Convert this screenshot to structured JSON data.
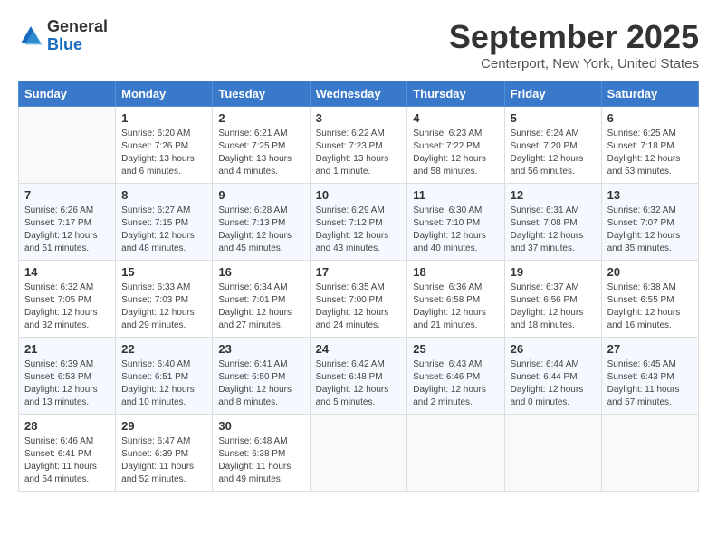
{
  "header": {
    "logo_general": "General",
    "logo_blue": "Blue",
    "month_year": "September 2025",
    "location": "Centerport, New York, United States"
  },
  "days_of_week": [
    "Sunday",
    "Monday",
    "Tuesday",
    "Wednesday",
    "Thursday",
    "Friday",
    "Saturday"
  ],
  "weeks": [
    [
      {
        "day": "",
        "info": ""
      },
      {
        "day": "1",
        "info": "Sunrise: 6:20 AM\nSunset: 7:26 PM\nDaylight: 13 hours\nand 6 minutes."
      },
      {
        "day": "2",
        "info": "Sunrise: 6:21 AM\nSunset: 7:25 PM\nDaylight: 13 hours\nand 4 minutes."
      },
      {
        "day": "3",
        "info": "Sunrise: 6:22 AM\nSunset: 7:23 PM\nDaylight: 13 hours\nand 1 minute."
      },
      {
        "day": "4",
        "info": "Sunrise: 6:23 AM\nSunset: 7:22 PM\nDaylight: 12 hours\nand 58 minutes."
      },
      {
        "day": "5",
        "info": "Sunrise: 6:24 AM\nSunset: 7:20 PM\nDaylight: 12 hours\nand 56 minutes."
      },
      {
        "day": "6",
        "info": "Sunrise: 6:25 AM\nSunset: 7:18 PM\nDaylight: 12 hours\nand 53 minutes."
      }
    ],
    [
      {
        "day": "7",
        "info": "Sunrise: 6:26 AM\nSunset: 7:17 PM\nDaylight: 12 hours\nand 51 minutes."
      },
      {
        "day": "8",
        "info": "Sunrise: 6:27 AM\nSunset: 7:15 PM\nDaylight: 12 hours\nand 48 minutes."
      },
      {
        "day": "9",
        "info": "Sunrise: 6:28 AM\nSunset: 7:13 PM\nDaylight: 12 hours\nand 45 minutes."
      },
      {
        "day": "10",
        "info": "Sunrise: 6:29 AM\nSunset: 7:12 PM\nDaylight: 12 hours\nand 43 minutes."
      },
      {
        "day": "11",
        "info": "Sunrise: 6:30 AM\nSunset: 7:10 PM\nDaylight: 12 hours\nand 40 minutes."
      },
      {
        "day": "12",
        "info": "Sunrise: 6:31 AM\nSunset: 7:08 PM\nDaylight: 12 hours\nand 37 minutes."
      },
      {
        "day": "13",
        "info": "Sunrise: 6:32 AM\nSunset: 7:07 PM\nDaylight: 12 hours\nand 35 minutes."
      }
    ],
    [
      {
        "day": "14",
        "info": "Sunrise: 6:32 AM\nSunset: 7:05 PM\nDaylight: 12 hours\nand 32 minutes."
      },
      {
        "day": "15",
        "info": "Sunrise: 6:33 AM\nSunset: 7:03 PM\nDaylight: 12 hours\nand 29 minutes."
      },
      {
        "day": "16",
        "info": "Sunrise: 6:34 AM\nSunset: 7:01 PM\nDaylight: 12 hours\nand 27 minutes."
      },
      {
        "day": "17",
        "info": "Sunrise: 6:35 AM\nSunset: 7:00 PM\nDaylight: 12 hours\nand 24 minutes."
      },
      {
        "day": "18",
        "info": "Sunrise: 6:36 AM\nSunset: 6:58 PM\nDaylight: 12 hours\nand 21 minutes."
      },
      {
        "day": "19",
        "info": "Sunrise: 6:37 AM\nSunset: 6:56 PM\nDaylight: 12 hours\nand 18 minutes."
      },
      {
        "day": "20",
        "info": "Sunrise: 6:38 AM\nSunset: 6:55 PM\nDaylight: 12 hours\nand 16 minutes."
      }
    ],
    [
      {
        "day": "21",
        "info": "Sunrise: 6:39 AM\nSunset: 6:53 PM\nDaylight: 12 hours\nand 13 minutes."
      },
      {
        "day": "22",
        "info": "Sunrise: 6:40 AM\nSunset: 6:51 PM\nDaylight: 12 hours\nand 10 minutes."
      },
      {
        "day": "23",
        "info": "Sunrise: 6:41 AM\nSunset: 6:50 PM\nDaylight: 12 hours\nand 8 minutes."
      },
      {
        "day": "24",
        "info": "Sunrise: 6:42 AM\nSunset: 6:48 PM\nDaylight: 12 hours\nand 5 minutes."
      },
      {
        "day": "25",
        "info": "Sunrise: 6:43 AM\nSunset: 6:46 PM\nDaylight: 12 hours\nand 2 minutes."
      },
      {
        "day": "26",
        "info": "Sunrise: 6:44 AM\nSunset: 6:44 PM\nDaylight: 12 hours\nand 0 minutes."
      },
      {
        "day": "27",
        "info": "Sunrise: 6:45 AM\nSunset: 6:43 PM\nDaylight: 11 hours\nand 57 minutes."
      }
    ],
    [
      {
        "day": "28",
        "info": "Sunrise: 6:46 AM\nSunset: 6:41 PM\nDaylight: 11 hours\nand 54 minutes."
      },
      {
        "day": "29",
        "info": "Sunrise: 6:47 AM\nSunset: 6:39 PM\nDaylight: 11 hours\nand 52 minutes."
      },
      {
        "day": "30",
        "info": "Sunrise: 6:48 AM\nSunset: 6:38 PM\nDaylight: 11 hours\nand 49 minutes."
      },
      {
        "day": "",
        "info": ""
      },
      {
        "day": "",
        "info": ""
      },
      {
        "day": "",
        "info": ""
      },
      {
        "day": "",
        "info": ""
      }
    ]
  ]
}
